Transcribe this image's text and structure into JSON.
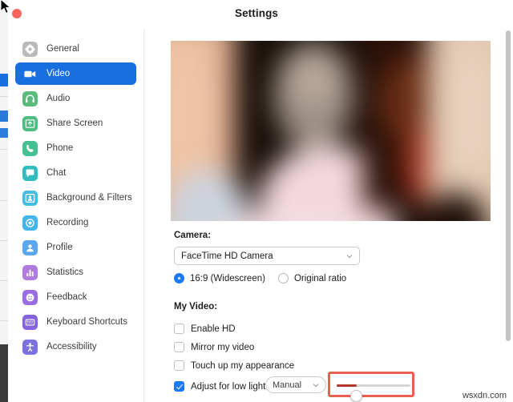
{
  "window": {
    "title": "Settings",
    "close_button_label": "",
    "accent_color": "#1a6fe0",
    "highlight_color": "#e8604e"
  },
  "sidebar": {
    "items": [
      {
        "label": "General",
        "icon": "gear-icon",
        "color": "#b9b9b9",
        "active": false
      },
      {
        "label": "Video",
        "icon": "video-camera-icon",
        "color": "#1a6fe0",
        "active": true
      },
      {
        "label": "Audio",
        "icon": "headphones-icon",
        "color": "#5bbb7b",
        "active": false
      },
      {
        "label": "Share Screen",
        "icon": "share-screen-icon",
        "color": "#4dbd84",
        "active": false
      },
      {
        "label": "Phone",
        "icon": "phone-icon",
        "color": "#46c193",
        "active": false
      },
      {
        "label": "Chat",
        "icon": "chat-bubble-icon",
        "color": "#32bcc0",
        "active": false
      },
      {
        "label": "Background & Filters",
        "icon": "person-frame-icon",
        "color": "#45bde2",
        "active": false
      },
      {
        "label": "Recording",
        "icon": "record-circle-icon",
        "color": "#45b6ed",
        "active": false
      },
      {
        "label": "Profile",
        "icon": "person-icon",
        "color": "#5aa7f0",
        "active": false
      },
      {
        "label": "Statistics",
        "icon": "bar-chart-icon",
        "color": "#b07be0",
        "active": false
      },
      {
        "label": "Feedback",
        "icon": "smiley-face-icon",
        "color": "#9a6ee0",
        "active": false
      },
      {
        "label": "Keyboard Shortcuts",
        "icon": "keyboard-icon",
        "color": "#8364dd",
        "active": false
      },
      {
        "label": "Accessibility",
        "icon": "accessibility-icon",
        "color": "#7b72e0",
        "active": false
      }
    ]
  },
  "content": {
    "camera_section_label": "Camera:",
    "camera_select_value": "FaceTime HD Camera",
    "aspect_ratio": {
      "widescreen_label": "16:9 (Widescreen)",
      "widescreen_selected": true,
      "original_label": "Original ratio",
      "original_selected": false
    },
    "my_video_label": "My Video:",
    "checkboxes": [
      {
        "label": "Enable HD",
        "checked": false
      },
      {
        "label": "Mirror my video",
        "checked": false
      },
      {
        "label": "Touch up my appearance",
        "checked": false
      },
      {
        "label": "Adjust for low light",
        "checked": true
      }
    ],
    "low_light_mode_value": "Manual",
    "low_light_slider": {
      "value_percent": 27,
      "min": 0,
      "max": 100,
      "highlighted": true
    }
  },
  "watermark": "wsxdn.com"
}
